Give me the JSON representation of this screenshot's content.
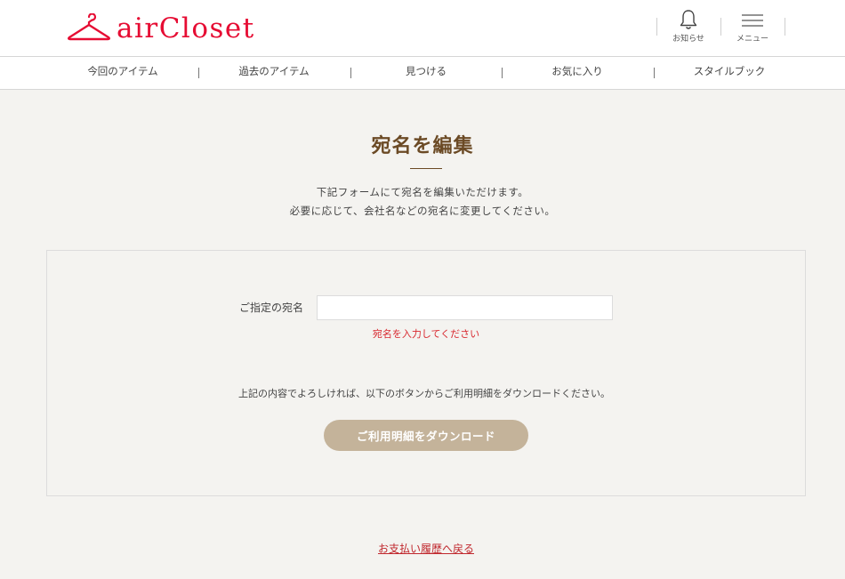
{
  "header": {
    "brand": "airCloset",
    "notifications_label": "お知らせ",
    "menu_label": "メニュー"
  },
  "nav": {
    "items": [
      {
        "label": "今回のアイテム"
      },
      {
        "label": "過去のアイテム"
      },
      {
        "label": "見つける"
      },
      {
        "label": "お気に入り"
      },
      {
        "label": "スタイルブック"
      }
    ]
  },
  "page": {
    "title": "宛名を編集",
    "description_line1": "下記フォームにて宛名を編集いただけます。",
    "description_line2": "必要に応じて、会社名などの宛名に変更してください。"
  },
  "form": {
    "field_label": "ご指定の宛名",
    "field_value": "",
    "field_placeholder": "",
    "error_message": "宛名を入力してください",
    "confirm_text": "上記の内容でよろしければ、以下のボタンからご利用明細をダウンロードください。",
    "download_button": "ご利用明細をダウンロード"
  },
  "footer": {
    "back_link": "お支払い履歴へ戻る"
  },
  "colors": {
    "brand": "#e60c33",
    "title": "#6b4a25",
    "button": "#c4b39a",
    "error": "#d8282f",
    "background": "#f4f3f0"
  }
}
